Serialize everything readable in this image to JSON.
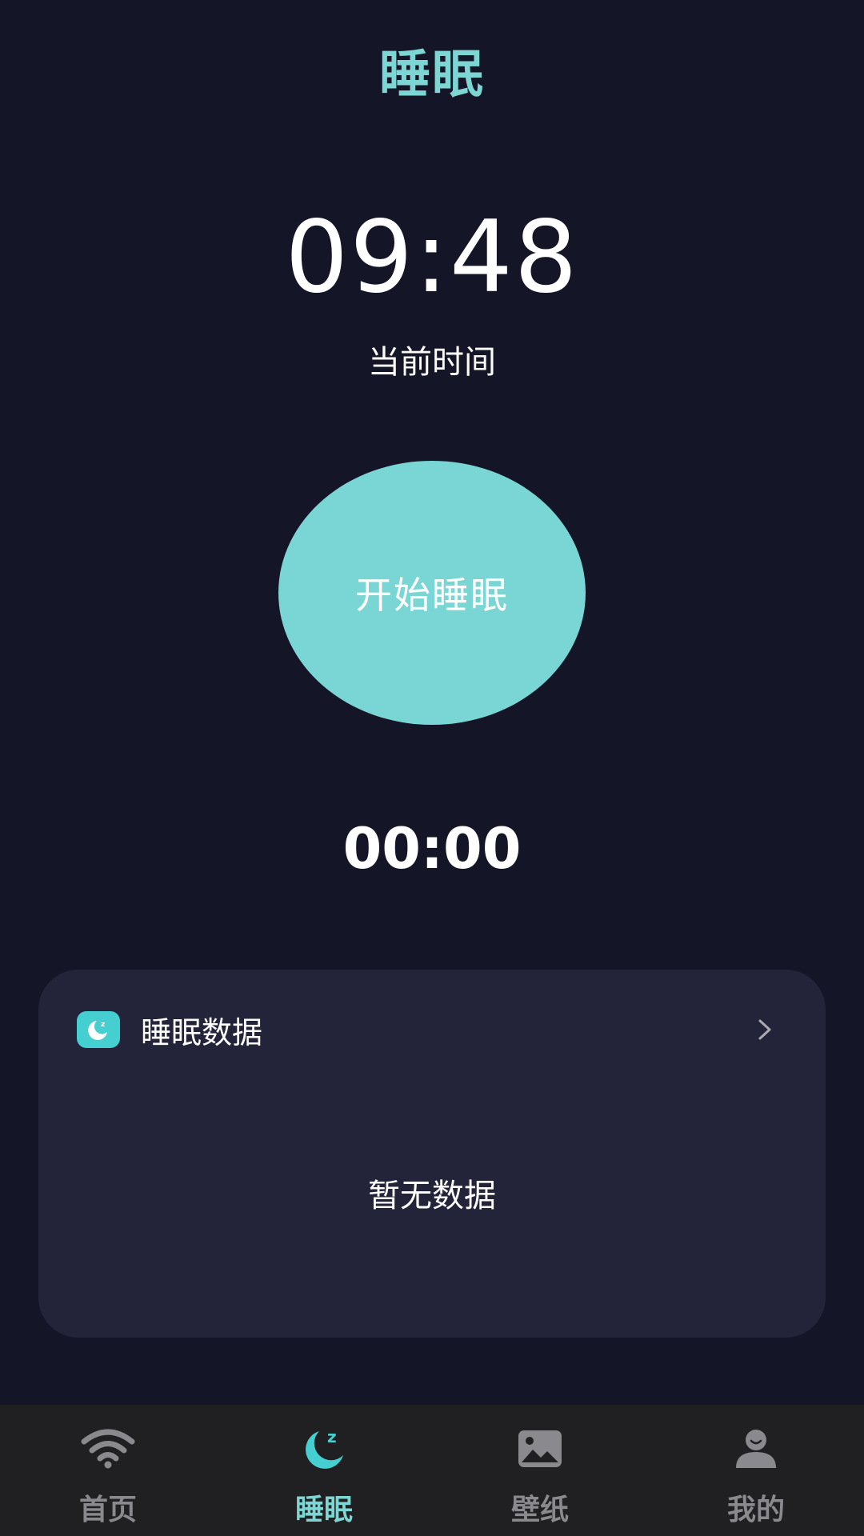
{
  "header": {
    "title": "睡眠"
  },
  "clock": {
    "time": "09:48",
    "caption": "当前时间"
  },
  "start_button": {
    "label": "开始睡眠"
  },
  "timer": {
    "value": "00:00"
  },
  "sleep_card": {
    "title": "睡眠数据",
    "empty_text": "暂无数据",
    "icon": "moon-sleep-icon"
  },
  "bottom_nav": {
    "items": [
      {
        "label": "首页",
        "icon": "wifi-icon",
        "active": false
      },
      {
        "label": "睡眠",
        "icon": "moon-sleep-icon",
        "active": true
      },
      {
        "label": "壁纸",
        "icon": "image-icon",
        "active": false
      },
      {
        "label": "我的",
        "icon": "user-icon",
        "active": false
      }
    ]
  },
  "colors": {
    "background": "#151528",
    "accent": "#7ed6d4",
    "card": "#23243a",
    "nav_background": "#202022",
    "nav_inactive": "#8a8a8e"
  }
}
